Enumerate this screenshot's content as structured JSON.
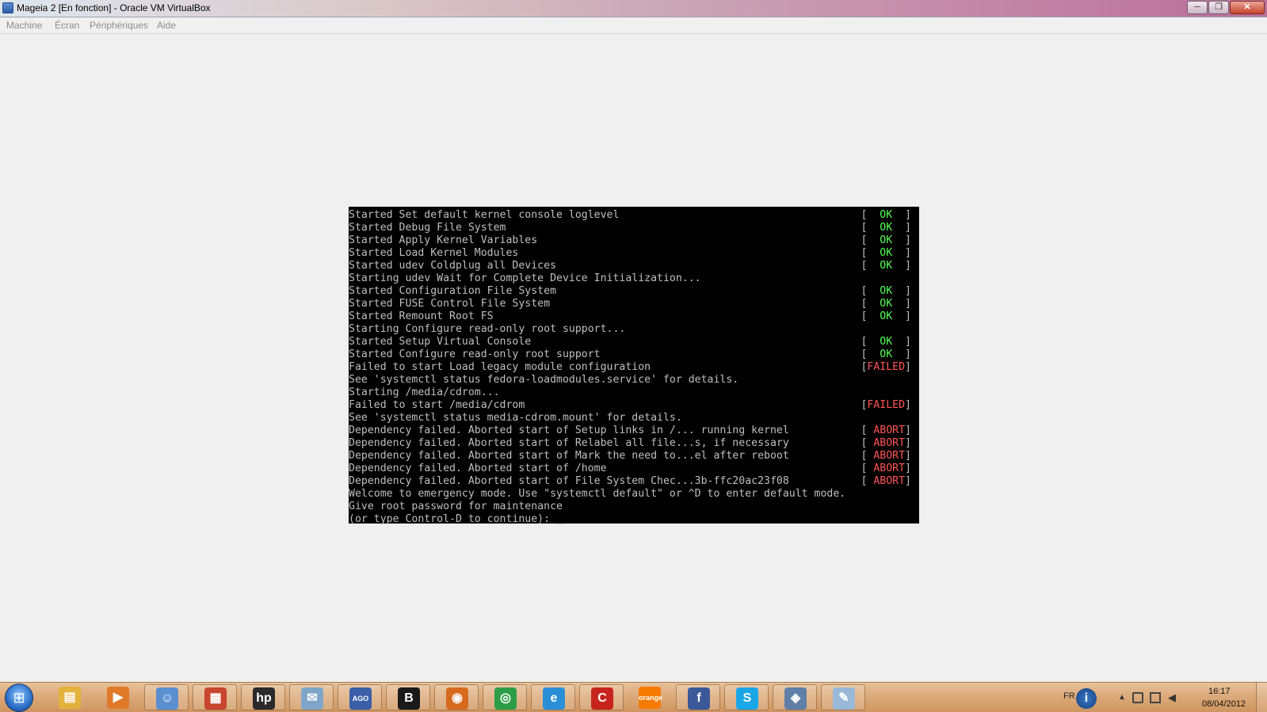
{
  "window": {
    "title": "Mageia 2 [En fonction] - Oracle VM VirtualBox",
    "controls": {
      "minimize": "─",
      "maximize": "❐",
      "close": "✕"
    }
  },
  "menu": {
    "items": [
      "Machine",
      "Écran",
      "Périphériques",
      "Aide"
    ]
  },
  "console": {
    "lines": [
      {
        "text": "Started Set default kernel console loglevel",
        "status": "OK"
      },
      {
        "text": "Started Debug File System",
        "status": "OK"
      },
      {
        "text": "Started Apply Kernel Variables",
        "status": "OK"
      },
      {
        "text": "Started Load Kernel Modules",
        "status": "OK"
      },
      {
        "text": "Started udev Coldplug all Devices",
        "status": "OK"
      },
      {
        "text": "Starting udev Wait for Complete Device Initialization...",
        "status": ""
      },
      {
        "text": "Started Configuration File System",
        "status": "OK"
      },
      {
        "text": "Started FUSE Control File System",
        "status": "OK"
      },
      {
        "text": "Started Remount Root FS",
        "status": "OK"
      },
      {
        "text": "Starting Configure read-only root support...",
        "status": ""
      },
      {
        "text": "Started Setup Virtual Console",
        "status": "OK"
      },
      {
        "text": "Started Configure read-only root support",
        "status": "OK"
      },
      {
        "text": "Failed to start Load legacy module configuration",
        "status": "FAILED"
      },
      {
        "text": "See 'systemctl status fedora-loadmodules.service' for details.",
        "status": ""
      },
      {
        "text": "Starting /media/cdrom...",
        "status": ""
      },
      {
        "text": "Failed to start /media/cdrom",
        "status": "FAILED"
      },
      {
        "text": "See 'systemctl status media-cdrom.mount' for details.",
        "status": ""
      },
      {
        "text": "Dependency failed. Aborted start of Setup links in /... running kernel",
        "status": "ABORT"
      },
      {
        "text": "Dependency failed. Aborted start of Relabel all file...s, if necessary",
        "status": "ABORT"
      },
      {
        "text": "Dependency failed. Aborted start of Mark the need to...el after reboot",
        "status": "ABORT"
      },
      {
        "text": "Dependency failed. Aborted start of /home",
        "status": "ABORT"
      },
      {
        "text": "Dependency failed. Aborted start of File System Chec...3b-ffc20ac23f08",
        "status": "ABORT"
      },
      {
        "text": "Welcome to emergency mode. Use \"systemctl default\" or ^D to enter default mode.",
        "status": ""
      },
      {
        "text": "Give root password for maintenance",
        "status": ""
      },
      {
        "text": "(or type Control-D to continue): _",
        "status": ""
      }
    ]
  },
  "taskbar": {
    "start_label": "⊞",
    "items": [
      {
        "icon": "file-explorer-icon",
        "glyph": "▤",
        "color": "#e3b23c"
      },
      {
        "icon": "media-player-icon",
        "glyph": "▶",
        "color": "#e07a2a"
      },
      {
        "icon": "users-app-icon",
        "glyph": "☺",
        "color": "#5a8fd0"
      },
      {
        "icon": "control-panel-icon",
        "glyph": "▦",
        "color": "#c8452e"
      },
      {
        "icon": "hp-icon",
        "glyph": "hp",
        "color": "#2a2a2a"
      },
      {
        "icon": "mail-icon",
        "glyph": "✉",
        "color": "#7fa6c8"
      },
      {
        "icon": "ago-icon",
        "glyph": "AGO",
        "color": "#3a5fa8"
      },
      {
        "icon": "b-app-icon",
        "glyph": "B",
        "color": "#1a1a1a"
      },
      {
        "icon": "firefox-icon",
        "glyph": "◉",
        "color": "#d86a1e"
      },
      {
        "icon": "chrome-icon",
        "glyph": "◎",
        "color": "#2e9d47"
      },
      {
        "icon": "internet-explorer-icon",
        "glyph": "e",
        "color": "#2b8fd8"
      },
      {
        "icon": "c-app-icon",
        "glyph": "C",
        "color": "#c8241e"
      },
      {
        "icon": "orange-icon",
        "glyph": "orange",
        "color": "#f57a00"
      },
      {
        "icon": "facebook-icon",
        "glyph": "f",
        "color": "#3b5998"
      },
      {
        "icon": "skype-icon",
        "glyph": "S",
        "color": "#1aa7e8"
      },
      {
        "icon": "virtualbox-icon",
        "glyph": "◈",
        "color": "#5f7fa8"
      },
      {
        "icon": "paint-icon",
        "glyph": "✎",
        "color": "#9ab8d8"
      }
    ],
    "tray": {
      "language": "FR",
      "time": "16:17",
      "date": "08/04/2012"
    }
  },
  "colors": {
    "console_bg": "#000000",
    "console_text": "#bfbfbf",
    "status_ok": "#55ff55",
    "status_fail": "#ff5555"
  }
}
